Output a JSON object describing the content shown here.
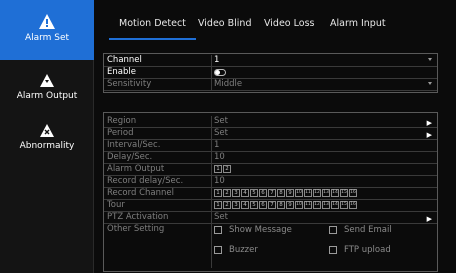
{
  "sidebar": {
    "items": [
      {
        "label": "Alarm Set",
        "icon": "alarm-set-icon"
      },
      {
        "label": "Alarm Output",
        "icon": "alarm-output-icon"
      },
      {
        "label": "Abnormality",
        "icon": "abnormality-icon"
      }
    ]
  },
  "tabs": [
    "Motion Detect",
    "Video Blind",
    "Video Loss",
    "Alarm Input"
  ],
  "top_panel": {
    "channel": {
      "label": "Channel",
      "value": "1"
    },
    "enable": {
      "label": "Enable"
    },
    "sensitivity": {
      "label": "Sensitivity",
      "value": "Middle"
    }
  },
  "bottom_panel": {
    "region": {
      "label": "Region",
      "value": "Set"
    },
    "period": {
      "label": "Period",
      "value": "Set"
    },
    "interval": {
      "label": "Interval/Sec.",
      "value": "1"
    },
    "delay": {
      "label": "Delay/Sec.",
      "value": "10"
    },
    "alarm_output": {
      "label": "Alarm Output",
      "boxes": [
        "1",
        "2"
      ]
    },
    "record_delay": {
      "label": "Record delay/Sec.",
      "value": "10"
    },
    "record_channel": {
      "label": "Record Channel",
      "boxes": [
        "1",
        "2",
        "3",
        "4",
        "5",
        "6",
        "7",
        "8",
        "9",
        "10",
        "11",
        "12",
        "13",
        "14",
        "15",
        "16"
      ]
    },
    "tour": {
      "label": "Tour",
      "boxes": [
        "1",
        "2",
        "3",
        "4",
        "5",
        "6",
        "7",
        "8",
        "9",
        "10",
        "11",
        "12",
        "13",
        "14",
        "15",
        "16"
      ]
    },
    "ptz": {
      "label": "PTZ Activation",
      "value": "Set"
    },
    "other": {
      "label": "Other Setting",
      "options": [
        "Show Message",
        "Send Email",
        "Buzzer",
        "FTP upload"
      ]
    }
  },
  "colors": {
    "accent": "#1f6fd6",
    "background": "#0b0b0b",
    "sidebar": "#141414"
  }
}
